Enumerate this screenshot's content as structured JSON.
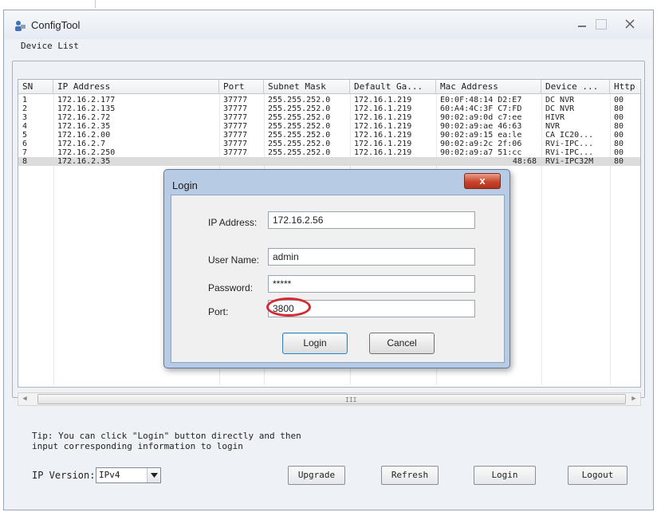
{
  "window": {
    "title": "ConfigTool"
  },
  "device_list": {
    "group_label": "Device List",
    "columns": [
      "SN",
      "IP Address",
      "Port",
      "Subnet Mask",
      "Default Ga...",
      "Mac Address",
      "Device ...",
      "Http"
    ],
    "rows": [
      [
        "1",
        "172.16.2.177",
        "37777",
        "255.255.252.0",
        "172.16.1.219",
        "E0:0F:48:14 D2:E7",
        "DC NVR",
        "00"
      ],
      [
        "2",
        "172.16.2.135",
        "37777",
        "255.255.252.0",
        "172.16.1.219",
        "60:A4:4C:3F C7:FD",
        "DC NVR",
        "80"
      ],
      [
        "3",
        "172.16.2.72",
        "37777",
        "255.255.252.0",
        "172.16.1.219",
        "90:02:a9:0d c7:ee",
        "HIVR",
        "00"
      ],
      [
        "4",
        "172.16.2.35",
        "37777",
        "255.255.252.0",
        "172.16.1.219",
        "90:02:a9:ae 46:63",
        "NVR",
        "80"
      ],
      [
        "5",
        "172.16.2.00",
        "37777",
        "255.255.252.0",
        "172.16.1.219",
        "90:02:a9:15 ea:le",
        "CA IC20...",
        "00"
      ],
      [
        "6",
        "172.16.2.7",
        "37777",
        "255.255.252.0",
        "172.16.1.219",
        "90:02:a9:2c 2f:06",
        "RVi-IPC...",
        "80"
      ],
      [
        "7",
        "172.16.2.250",
        "37777",
        "255.255.252.0",
        "172.16.1.219",
        "90:02:a9:a7 51:cc",
        "RVi-IPC...",
        "00"
      ],
      [
        "8",
        "172.16.2.35",
        "",
        "",
        "",
        "48:68",
        "RVi-IPC32M",
        "80"
      ]
    ]
  },
  "scrollbar": {
    "grip": "III"
  },
  "tip": "Tip: You can click \"Login\" button directly and then input corresponding information to login",
  "ip_version": {
    "label": "IP Version:",
    "value": "IPv4"
  },
  "buttons": {
    "upgrade": "Upgrade",
    "refresh": "Refresh",
    "login": "Login",
    "logout": "Logout"
  },
  "dialog": {
    "title": "Login",
    "close_glyph": "x",
    "ip_label": "IP Address:",
    "ip_value": "172.16.2.56",
    "user_label": "User Name:",
    "user_value": "admin",
    "password_label": "Password:",
    "password_value": "*****",
    "port_label": "Port:",
    "port_value": "3800",
    "login_button": "Login",
    "cancel_button": "Cancel"
  },
  "colors": {
    "dialog_frame": "#b8cbe4",
    "close_button": "#c9452c",
    "highlight": "#d42a36",
    "selected_row": "#dcdcdc"
  }
}
